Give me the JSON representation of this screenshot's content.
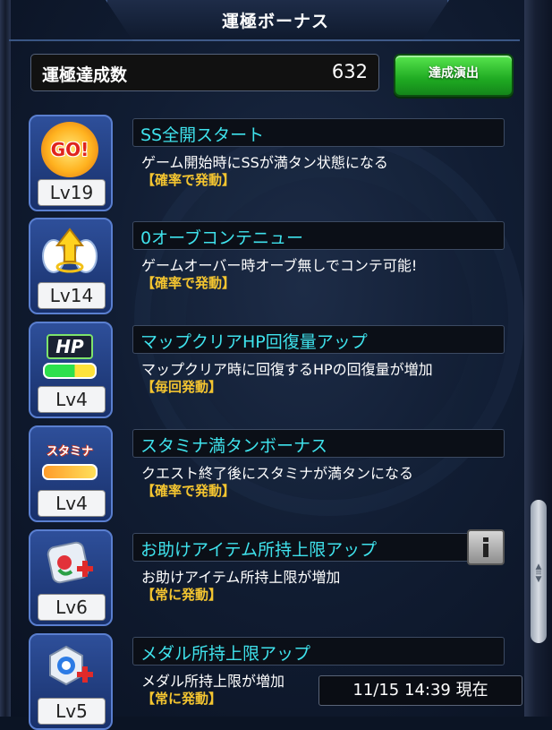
{
  "header": {
    "title": "運極ボーナス"
  },
  "summary": {
    "label": "運極達成数",
    "value": "632",
    "button_label": "達成演出"
  },
  "items": [
    {
      "level": "Lv19",
      "icon": "ss-go-icon",
      "icon_text": "GO!",
      "title": "SS全開スタート",
      "description": "ゲーム開始時にSSが満タン状態になる",
      "trigger": "【確率で発動】"
    },
    {
      "level": "Lv14",
      "icon": "winged-arrow-icon",
      "title": "0オーブコンテニュー",
      "description": "ゲームオーバー時オーブ無しでコンテ可能!",
      "trigger": "【確率で発動】"
    },
    {
      "level": "Lv4",
      "icon": "hp-recovery-icon",
      "icon_text": "HP",
      "title": "マップクリアHP回復量アップ",
      "description": "マップクリア時に回復するHPの回復量が増加",
      "trigger": "【毎回発動】"
    },
    {
      "level": "Lv4",
      "icon": "stamina-icon",
      "icon_text": "スタミナ",
      "title": "スタミナ満タンボーナス",
      "description": "クエスト終了後にスタミナが満タンになる",
      "trigger": "【確率で発動】"
    },
    {
      "level": "Lv6",
      "icon": "help-item-icon",
      "title": "お助けアイテム所持上限アップ",
      "description": "お助けアイテム所持上限が増加",
      "trigger": "【常に発動】"
    },
    {
      "level": "Lv5",
      "icon": "medal-icon",
      "title": "メダル所持上限アップ",
      "description": "メダル所持上限が増加",
      "trigger": "【常に発動】"
    }
  ],
  "timestamp": "11/15 14:39 現在",
  "colors": {
    "title_text": "#3fe2ec",
    "trigger_text": "#f4c530",
    "button_green": "#2bb52b",
    "badge_blue": "#2e4f9a"
  }
}
